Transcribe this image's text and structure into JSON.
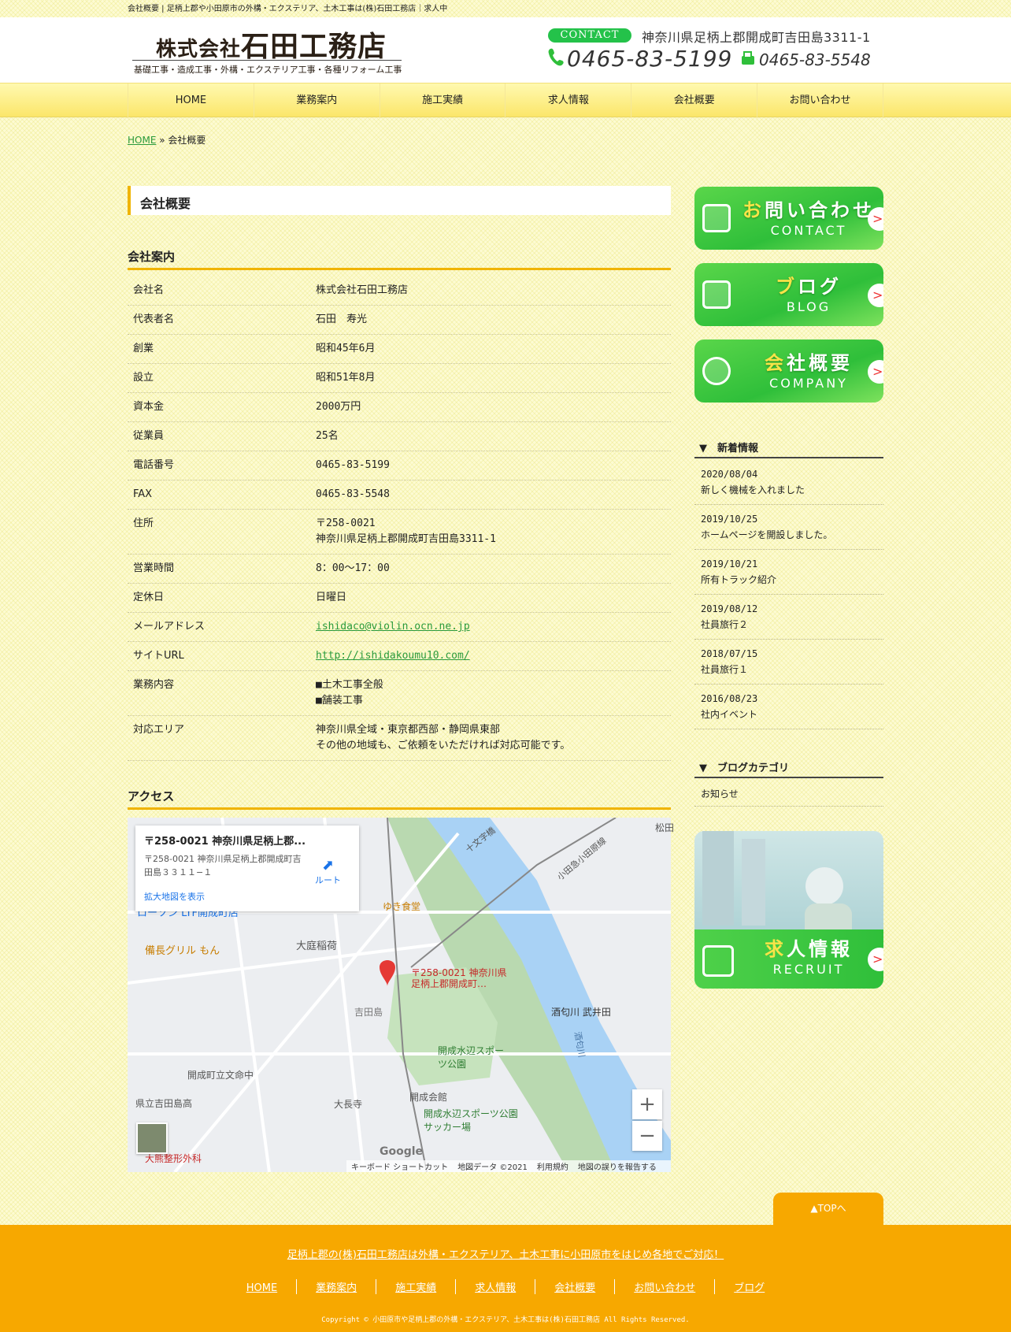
{
  "topbar": {
    "text": "会社概要 | 足柄上郡や小田原市の外構・エクステリア、土木工事は(株)石田工務店｜求人中"
  },
  "header": {
    "logo_main_small": "株式会社",
    "logo_main": "石田工務店",
    "logo_sub": "基礎工事・造成工事・外構・エクステリア工事・各種リフォーム工事",
    "contact_label": "CONTACT",
    "address": "神奈川県足柄上郡開成町吉田島3311-1",
    "tel": "0465-83-5199",
    "fax": "0465-83-5548"
  },
  "nav": [
    "HOME",
    "業務案内",
    "施工実績",
    "求人情報",
    "会社概要",
    "お問い合わせ"
  ],
  "breadcrumb": {
    "home": "HOME",
    "sep": "»",
    "current": "会社概要"
  },
  "page_title": "会社概要",
  "company": {
    "heading": "会社案内",
    "rows": [
      {
        "k": "会社名",
        "v": "株式会社石田工務店"
      },
      {
        "k": "代表者名",
        "v": "石田　寿光"
      },
      {
        "k": "創業",
        "v": "昭和45年6月"
      },
      {
        "k": "設立",
        "v": "昭和51年8月"
      },
      {
        "k": "資本金",
        "v": "2000万円"
      },
      {
        "k": "従業員",
        "v": "25名"
      },
      {
        "k": "電話番号",
        "v": "0465-83-5199"
      },
      {
        "k": "FAX",
        "v": "0465-83-5548"
      },
      {
        "k": "住所",
        "v": "〒258-0021",
        "v2": "神奈川県足柄上郡開成町吉田島3311-1"
      },
      {
        "k": "営業時間",
        "v": "8：00～17：00"
      },
      {
        "k": "定休日",
        "v": "日曜日"
      },
      {
        "k": "メールアドレス",
        "link": "ishidaco@violin.ocn.ne.jp"
      },
      {
        "k": "サイトURL",
        "link": "http://ishidakoumu10.com/"
      },
      {
        "k": "業務内容",
        "v": "■土木工事全般",
        "v2": "■舗装工事"
      },
      {
        "k": "対応エリア",
        "v": "神奈川県全域・東京都西部・静岡県東部",
        "v2": "その他の地域も、ご依頼をいただければ対応可能です。"
      }
    ]
  },
  "access": {
    "heading": "アクセス",
    "card_title": "〒258-0021 神奈川県足柄上郡...",
    "card_address": "〒258-0021 神奈川県足柄上郡開成町吉田島３３１１−１",
    "card_link": "拡大地図を表示",
    "route": "ルート",
    "marker_label": "〒258-0021 神奈川県足柄上郡開成町…",
    "places": [
      "ローソン LTF開成町店",
      "備長グリル もん",
      "大庭稲荷",
      "吉田島",
      "開成水辺スポーツ公園",
      "酒匂川 武井田",
      "開成町立文命中",
      "県立吉田島高",
      "大長寺",
      "開成会館",
      "開成水辺スポーツ公園サッカー場",
      "ゆき食堂",
      "十文字橋",
      "小田急小田原線",
      "酒匂川",
      "大熊整形外科",
      "松田"
    ],
    "footer": [
      "キーボード ショートカット",
      "地図データ ©2021",
      "利用規約",
      "地図の誤りを報告する"
    ],
    "google": "Google"
  },
  "sidebar": {
    "banners": [
      {
        "jp_accent": "お",
        "jp": "問い合わせ",
        "en": "CONTACT",
        "icon": "mail-icon"
      },
      {
        "jp_accent": "ブ",
        "jp": "ログ",
        "en": "BLOG",
        "icon": "pencil-icon"
      },
      {
        "jp_accent": "会",
        "jp": "社概要",
        "en": "COMPANY",
        "icon": "helmet-icon"
      }
    ],
    "news_heading": "▼　新着情報",
    "news": [
      {
        "date": "2020/08/04",
        "title": "新しく機械を入れました"
      },
      {
        "date": "2019/10/25",
        "title": "ホームページを開設しました。"
      },
      {
        "date": "2019/10/21",
        "title": "所有トラック紹介"
      },
      {
        "date": "2019/08/12",
        "title": "社員旅行２"
      },
      {
        "date": "2018/07/15",
        "title": "社員旅行１"
      },
      {
        "date": "2016/08/23",
        "title": "社内イベント"
      }
    ],
    "category_heading": "▼　ブログカテゴリ",
    "categories": [
      "お知らせ"
    ],
    "recruit": {
      "jp_accent": "求",
      "jp": "人情報",
      "en": "RECRUIT"
    }
  },
  "totop": "▲TOPへ",
  "footer": {
    "message": "足柄上郡の(株)石田工務店は外構・エクステリア、土木工事に小田原市をはじめ各地でご対応！",
    "links": [
      "HOME",
      "業務案内",
      "施工実績",
      "求人情報",
      "会社概要",
      "お問い合わせ",
      "ブログ"
    ],
    "copyright": "Copyright © 小田原市や足柄上郡の外構・エクステリア、土木工事は(株)石田工務店 All Rights Reserved."
  },
  "colors": {
    "accent": "#f0b400",
    "green": "#2fbf3a",
    "footer": "#f7a800",
    "link": "#2a9a3c"
  }
}
